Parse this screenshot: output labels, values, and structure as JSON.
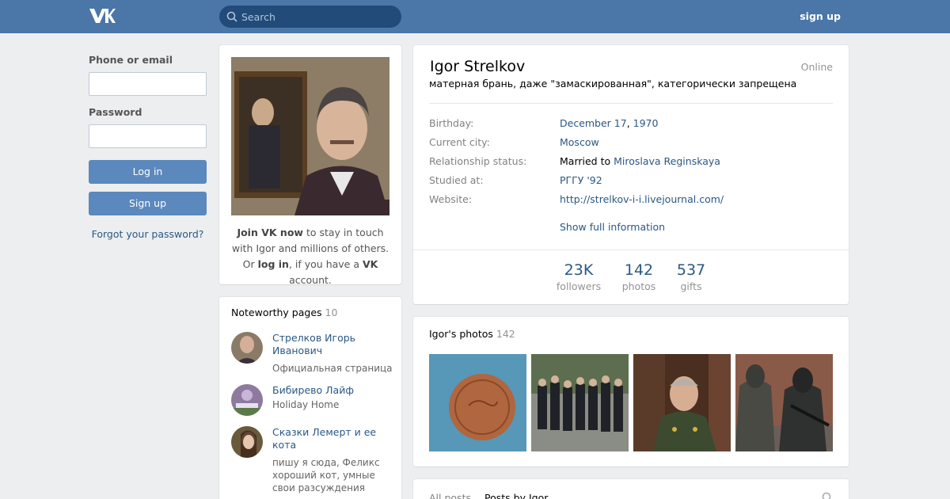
{
  "header": {
    "logo": "vk-logo",
    "search_placeholder": "Search",
    "signup_label": "sign up",
    "colors": {
      "bar": "#4a76a8",
      "search": "#224b7a"
    }
  },
  "login": {
    "phone_label": "Phone or email",
    "password_label": "Password",
    "login_button": "Log in",
    "signup_button": "Sign up",
    "forgot_link": "Forgot your password?"
  },
  "avatar": {
    "join_bold": "Join VK now",
    "join_rest": " to stay in touch with Igor and millions of others.",
    "or": "Or ",
    "login_link": "log in",
    "if_text": ", if you have a ",
    "vk": "VK",
    "account": " account."
  },
  "noteworthy": {
    "title": "Noteworthy pages",
    "count": "10",
    "pages": [
      {
        "name": "Стрелков Игорь Иванович",
        "desc": "Официальная страница"
      },
      {
        "name": "Бибирево Лайф",
        "desc": "Holiday Home"
      },
      {
        "name": "Сказки Лемерт и ее кота",
        "desc": "пишу я сюда, Феликс хороший кот, умные свои разсуждения"
      }
    ]
  },
  "profile": {
    "name": "Igor Strelkov",
    "online": "Online",
    "status": "матерная брань, даже \"замаскированная\", категорически запрещена",
    "birthday_label": "Birthday:",
    "birthday_day": "December 17",
    "birthday_comma": ", ",
    "birthday_year": "1970",
    "city_label": "Current city:",
    "city": "Moscow",
    "relationship_label": "Relationship status:",
    "relationship_prefix": "Married to ",
    "relationship_partner": "Miroslava Reginskaya",
    "studied_label": "Studied at:",
    "studied": "РГГУ '92",
    "website_label": "Website:",
    "website": "http://strelkov-i-i.livejournal.com/",
    "show_full": "Show full information",
    "counters": [
      {
        "value": "23K",
        "label": "followers"
      },
      {
        "value": "142",
        "label": "photos"
      },
      {
        "value": "537",
        "label": "gifts"
      }
    ]
  },
  "photos": {
    "title": "Igor's photos",
    "count": "142"
  },
  "posts": {
    "tab_all": "All posts",
    "tab_by": "Posts by Igor"
  },
  "icons": {
    "search": "search-icon",
    "posts_search": "search-icon"
  }
}
